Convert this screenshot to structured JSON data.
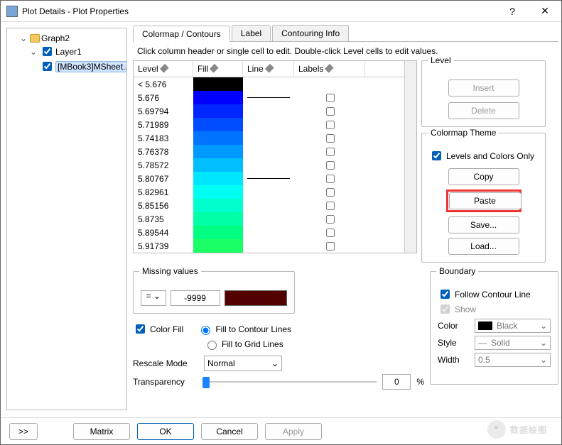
{
  "window": {
    "title": "Plot Details - Plot Properties",
    "help_icon": "?",
    "close_icon": "✕"
  },
  "tree": {
    "root": "Graph2",
    "layer": "Layer1",
    "item": "[MBook3]MSheet..."
  },
  "tabs": {
    "t1": "Colormap / Contours",
    "t2": "Label",
    "t3": "Contouring Info"
  },
  "instruction": "Click column header or single cell to edit. Double-click Level cells to edit values.",
  "table": {
    "headers": {
      "level": "Level",
      "fill": "Fill",
      "line": "Line",
      "labels": "Labels"
    },
    "rows": [
      {
        "level": "< 5.676",
        "fill": "#000000",
        "line": false
      },
      {
        "level": "5.676",
        "fill": "#0000FF",
        "line": true
      },
      {
        "level": "5.69794",
        "fill": "#0026FF",
        "line": false
      },
      {
        "level": "5.71989",
        "fill": "#004CFF",
        "line": false
      },
      {
        "level": "5.74183",
        "fill": "#0073FF",
        "line": false
      },
      {
        "level": "5.76378",
        "fill": "#0099FF",
        "line": false
      },
      {
        "level": "5.78572",
        "fill": "#00BFFF",
        "line": false
      },
      {
        "level": "5.80767",
        "fill": "#00E6FF",
        "line": true
      },
      {
        "level": "5.82961",
        "fill": "#00FFF2",
        "line": false
      },
      {
        "level": "5.85156",
        "fill": "#00FFCC",
        "line": false
      },
      {
        "level": "5.8735",
        "fill": "#00FFA6",
        "line": false
      },
      {
        "level": "5.89544",
        "fill": "#00FF80",
        "line": false
      },
      {
        "level": "5.91739",
        "fill": "#1AFF66",
        "line": false
      }
    ]
  },
  "level_panel": {
    "title": "Level",
    "insert": "Insert",
    "delete": "Delete"
  },
  "theme_panel": {
    "title": "Colormap Theme",
    "levels_only": "Levels and Colors Only",
    "copy": "Copy",
    "paste": "Paste",
    "save": "Save...",
    "load": "Load..."
  },
  "missing": {
    "title": "Missing values",
    "op": "=",
    "value": "-9999",
    "color_fill": "Color Fill",
    "fill_contour": "Fill to Contour Lines",
    "fill_grid": "Fill to Grid Lines"
  },
  "boundary": {
    "title": "Boundary",
    "follow": "Follow Contour Line",
    "show": "Show",
    "color_lbl": "Color",
    "color_val": "Black",
    "style_lbl": "Style",
    "style_val": "Solid",
    "width_lbl": "Width",
    "width_val": "0.5"
  },
  "rescale": {
    "label": "Rescale Mode",
    "value": "Normal"
  },
  "transparency": {
    "label": "Transparency",
    "value": "0",
    "pct": "%"
  },
  "footer": {
    "expand": ">>",
    "matrix": "Matrix",
    "ok": "OK",
    "cancel": "Cancel",
    "apply": "Apply"
  },
  "watermark": "数据绘图"
}
